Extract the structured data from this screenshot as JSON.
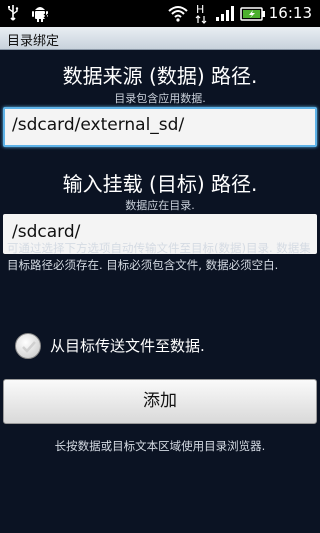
{
  "status_bar": {
    "time": "16:13",
    "icons": [
      "usb-icon",
      "android-debug-icon",
      "wifi-icon",
      "hspa-icon",
      "signal-icon",
      "battery-icon"
    ],
    "network_label": "H"
  },
  "title_bar": {
    "title": "目录绑定"
  },
  "source": {
    "heading": "数据来源 (数据) 路径.",
    "hint": "目录包含应用数据.",
    "value": "/sdcard/external_sd/"
  },
  "target": {
    "heading": "输入挂载 (目标) 路径.",
    "hint": "数据应在目录.",
    "value": "/sdcard/"
  },
  "description": "可通过选择下方选项自动传输文件至目标(数据)目录. 数据集目标路径必须存在. 目标必须包含文件, 数据必须空白.",
  "transfer_option": {
    "label": "从目标传送文件至数据.",
    "checked": false
  },
  "add_button_label": "添加",
  "footer_hint": "长按数据或目标文本区域使用目录浏览器.",
  "colors": {
    "background": "#0b1323",
    "focus": "#5fb3e8",
    "battery": "#4caf2e"
  }
}
